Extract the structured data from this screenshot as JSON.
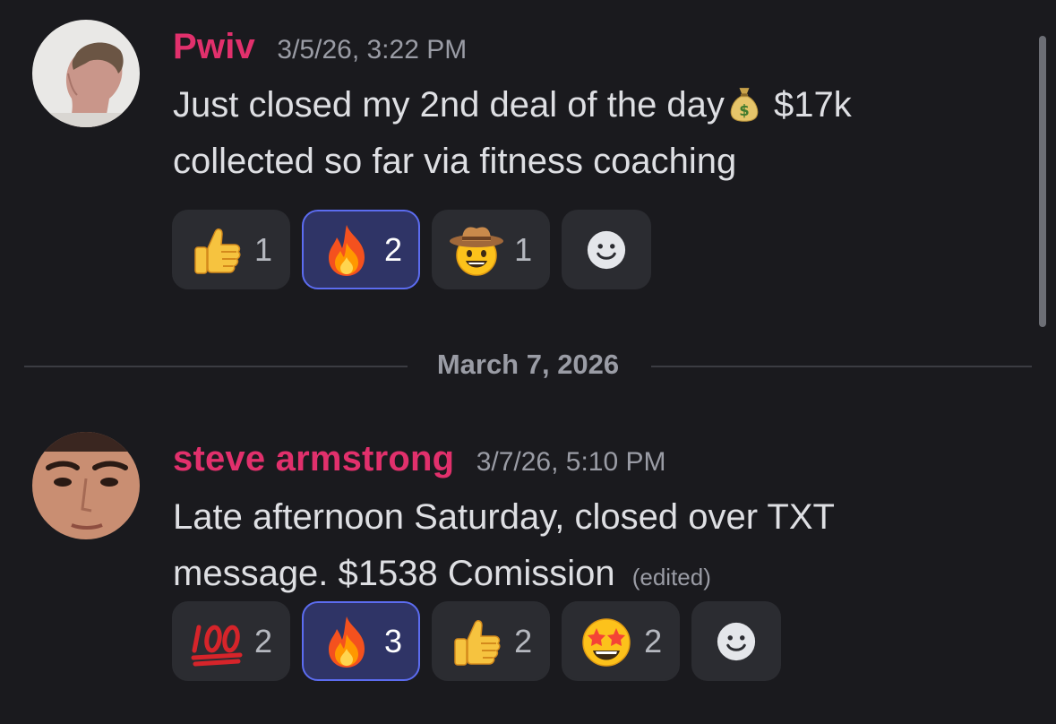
{
  "messages": [
    {
      "username": "Pwiv",
      "timestamp": "3/5/26, 3:22 PM",
      "text_before_emoji": "Just closed my 2nd deal of the day",
      "inline_emoji": "money-bag",
      "text_after_emoji": " $17k collected so far via fitness coaching",
      "reactions": [
        {
          "emoji": "thumbs-up",
          "count": "1",
          "active": false
        },
        {
          "emoji": "fire",
          "count": "2",
          "active": true
        },
        {
          "emoji": "cowboy-face",
          "count": "1",
          "active": false
        }
      ]
    },
    {
      "username": "steve armstrong",
      "timestamp": "3/7/26, 5:10 PM",
      "text": "Late afternoon Saturday, closed over TXT message. $1538 Comission",
      "edited_label": "(edited)",
      "reactions": [
        {
          "emoji": "hundred-points",
          "count": "2",
          "active": false
        },
        {
          "emoji": "fire",
          "count": "3",
          "active": true
        },
        {
          "emoji": "thumbs-up",
          "count": "2",
          "active": false
        },
        {
          "emoji": "star-struck",
          "count": "2",
          "active": false
        }
      ]
    }
  ],
  "date_divider": "March 7, 2026",
  "colors": {
    "background": "#1a1a1e",
    "username": "#e1306c",
    "reaction_bg": "#2b2c31",
    "reaction_active_bg": "#2f3466",
    "reaction_active_border": "#5c6cf0"
  }
}
